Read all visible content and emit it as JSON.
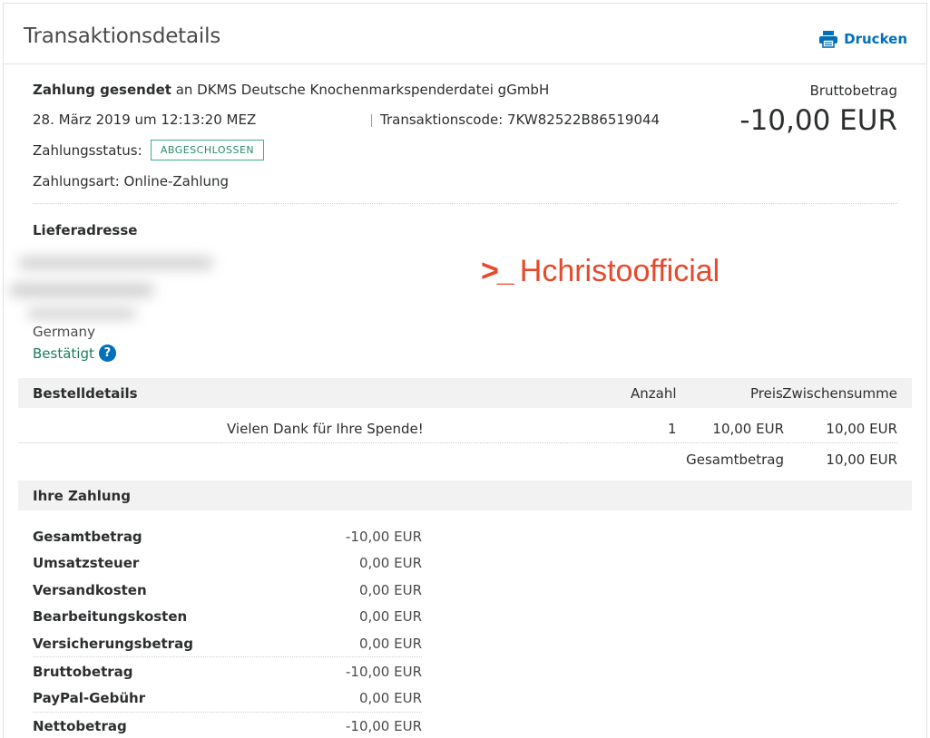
{
  "header": {
    "title": "Transaktionsdetails",
    "print_label": "Drucken"
  },
  "summary": {
    "sent_label": "Zahlung gesendet",
    "recipient": "an DKMS Deutsche Knochenmarkspenderdatei gGmbH",
    "datetime": "28. März 2019 um 12:13:20 MEZ",
    "transaction_code": "Transaktionscode: 7KW82522B86519044",
    "status_label": "Zahlungsstatus:",
    "status_badge": "ABGESCHLOSSEN",
    "payment_type": "Zahlungsart: Online-Zahlung",
    "gross_label": "Bruttobetrag",
    "gross_value": "-10,00 EUR",
    "accent_color": "#3cae8a"
  },
  "address": {
    "label": "Lieferadresse",
    "country": "Germany",
    "verified": "Bestätigt",
    "help_icon": "question-icon"
  },
  "watermark": {
    "prompt": ">_",
    "text": "Hchristoofficial"
  },
  "order": {
    "title": "Bestelldetails",
    "col_qty": "Anzahl",
    "col_price": "Preis",
    "col_subtotal": "Zwischensumme",
    "items": [
      {
        "description": "Vielen Dank für Ihre Spende!",
        "qty": "1",
        "price": "10,00 EUR",
        "subtotal": "10,00 EUR"
      }
    ],
    "total_label": "Gesamtbetrag",
    "total_value": "10,00 EUR"
  },
  "payment": {
    "title": "Ihre Zahlung",
    "rows": [
      {
        "label": "Gesamtbetrag",
        "value": "-10,00 EUR"
      },
      {
        "label": "Umsatzsteuer",
        "value": "0,00 EUR"
      },
      {
        "label": "Versandkosten",
        "value": "0,00 EUR"
      },
      {
        "label": "Bearbeitungskosten",
        "value": "0,00 EUR"
      },
      {
        "label": "Versicherungsbetrag",
        "value": "0,00 EUR"
      },
      {
        "label": "Bruttobetrag",
        "value": "-10,00 EUR"
      },
      {
        "label": "PayPal-Gebühr",
        "value": "0,00 EUR"
      },
      {
        "label": "Nettobetrag",
        "value": "-10,00 EUR"
      }
    ]
  }
}
